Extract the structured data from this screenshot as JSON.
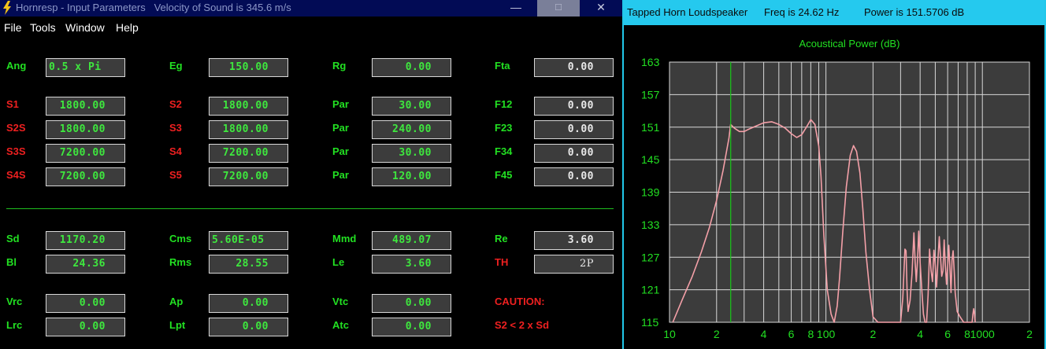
{
  "left_window": {
    "title": "Hornresp - Input Parameters   Velocity of Sound is 345.6 m/s",
    "controls": {
      "minimize": "—",
      "maximize": "☐",
      "close": "✕"
    },
    "menu": [
      "File",
      "Tools",
      "Window",
      "Help"
    ],
    "params": {
      "ang": {
        "label": "Ang",
        "value": "0.5 x Pi"
      },
      "eg": {
        "label": "Eg",
        "value": "150.00"
      },
      "rg": {
        "label": "Rg",
        "value": "0.00"
      },
      "fta": {
        "label": "Fta",
        "value": "0.00"
      },
      "s1": {
        "label": "S1",
        "value": "1800.00"
      },
      "s2": {
        "label": "S2",
        "value": "1800.00"
      },
      "par1": {
        "label": "Par",
        "value": "30.00"
      },
      "f12": {
        "label": "F12",
        "value": "0.00"
      },
      "s2s": {
        "label": "S2S",
        "value": "1800.00"
      },
      "s3": {
        "label": "S3",
        "value": "1800.00"
      },
      "par2": {
        "label": "Par",
        "value": "240.00"
      },
      "f23": {
        "label": "F23",
        "value": "0.00"
      },
      "s3s": {
        "label": "S3S",
        "value": "7200.00"
      },
      "s4": {
        "label": "S4",
        "value": "7200.00"
      },
      "par3": {
        "label": "Par",
        "value": "30.00"
      },
      "f34": {
        "label": "F34",
        "value": "0.00"
      },
      "s4s": {
        "label": "S4S",
        "value": "7200.00"
      },
      "s5": {
        "label": "S5",
        "value": "7200.00"
      },
      "par4": {
        "label": "Par",
        "value": "120.00"
      },
      "f45": {
        "label": "F45",
        "value": "0.00"
      },
      "sd": {
        "label": "Sd",
        "value": "1170.20"
      },
      "cms": {
        "label": "Cms",
        "value": "5.60E-05"
      },
      "mmd": {
        "label": "Mmd",
        "value": "489.07"
      },
      "re": {
        "label": "Re",
        "value": "3.60"
      },
      "bl": {
        "label": "Bl",
        "value": "24.36"
      },
      "rms": {
        "label": "Rms",
        "value": "28.55"
      },
      "le": {
        "label": "Le",
        "value": "3.60"
      },
      "th": {
        "label": "TH",
        "value": "2P"
      },
      "vrc": {
        "label": "Vrc",
        "value": "0.00"
      },
      "ap": {
        "label": "Ap",
        "value": "0.00"
      },
      "vtc": {
        "label": "Vtc",
        "value": "0.00"
      },
      "lrc": {
        "label": "Lrc",
        "value": "0.00"
      },
      "lpt": {
        "label": "Lpt",
        "value": "0.00"
      },
      "atc": {
        "label": "Atc",
        "value": "0.00"
      }
    },
    "caution": {
      "heading": "CAUTION:",
      "message": "S2 < 2 x Sd"
    }
  },
  "right_window": {
    "title": "Tapped Horn Loudspeaker",
    "freq": "Freq is 24.62 Hz",
    "power": "Power is 151.5706 dB"
  },
  "colors": {
    "curve": "#f4a0a8",
    "cursor": "#18c818",
    "label_green": "#22e022",
    "label_red": "#ee2020",
    "title_cyan": "#25c9ee"
  },
  "chart_data": {
    "type": "line",
    "title": "Acoustical Power (dB)",
    "xscale": "log",
    "xlim": [
      10,
      2000
    ],
    "ylim": [
      115,
      163
    ],
    "yticks": [
      "163",
      "157",
      "151",
      "145",
      "139",
      "133",
      "127",
      "121",
      "115"
    ],
    "xticks": [
      {
        "v": 10,
        "label": "10"
      },
      {
        "v": 20,
        "label": "2"
      },
      {
        "v": 40,
        "label": "4"
      },
      {
        "v": 60,
        "label": "6"
      },
      {
        "v": 80,
        "label": "8"
      },
      {
        "v": 100,
        "label": "100"
      },
      {
        "v": 200,
        "label": "2"
      },
      {
        "v": 400,
        "label": "4"
      },
      {
        "v": 600,
        "label": "6"
      },
      {
        "v": 800,
        "label": "8"
      },
      {
        "v": 1000,
        "label": "1000"
      },
      {
        "v": 2000,
        "label": "2"
      }
    ],
    "cursor_x": 24.62,
    "series": [
      {
        "x": [
          10.5,
          12,
          14,
          16,
          18,
          20,
          22,
          24,
          24.6,
          26,
          28,
          30,
          32,
          35,
          40,
          45,
          50,
          55,
          60,
          65,
          70,
          75,
          80,
          85,
          90,
          93,
          97,
          102,
          108,
          113,
          118,
          122,
          128,
          135,
          143,
          150,
          157,
          165,
          172,
          180,
          190,
          200,
          215,
          230,
          250,
          275,
          300,
          310,
          320,
          325,
          330,
          335,
          345,
          355,
          365,
          372,
          378,
          385,
          392,
          400,
          410,
          420,
          430,
          440,
          450,
          460,
          470,
          480,
          490,
          500,
          510,
          520,
          530,
          540,
          550,
          560,
          570,
          580,
          590,
          600,
          610,
          620,
          630,
          640,
          650,
          660,
          670,
          690,
          720,
          760,
          800,
          830,
          860,
          870,
          880,
          890,
          900
        ],
        "y": [
          115,
          119,
          123.5,
          128,
          132.5,
          137.5,
          143,
          149,
          151.5,
          150.8,
          150.2,
          150.2,
          150.6,
          151.1,
          151.8,
          152.0,
          151.5,
          150.8,
          149.8,
          149.1,
          149.6,
          151.0,
          152.4,
          151.5,
          147.5,
          142,
          131,
          121,
          116.5,
          115,
          118,
          123,
          131.5,
          140,
          145.8,
          147.6,
          146.5,
          142.5,
          136,
          128,
          121,
          116,
          115,
          115,
          115,
          115,
          115,
          119.5,
          128.5,
          128.2,
          121,
          117,
          119,
          124,
          131.5,
          126,
          122.5,
          126.5,
          131.8,
          126,
          121,
          116.5,
          115,
          115,
          120,
          128.5,
          124.5,
          122.5,
          128.3,
          125.5,
          121.5,
          126.5,
          130.8,
          127,
          123.5,
          124.5,
          130.2,
          125.5,
          122,
          125.5,
          129.2,
          125,
          120.5,
          126.5,
          128.2,
          124.5,
          120.5,
          117,
          116,
          115,
          115,
          115,
          115,
          116.5,
          117.5,
          116.5,
          115
        ]
      }
    ]
  }
}
